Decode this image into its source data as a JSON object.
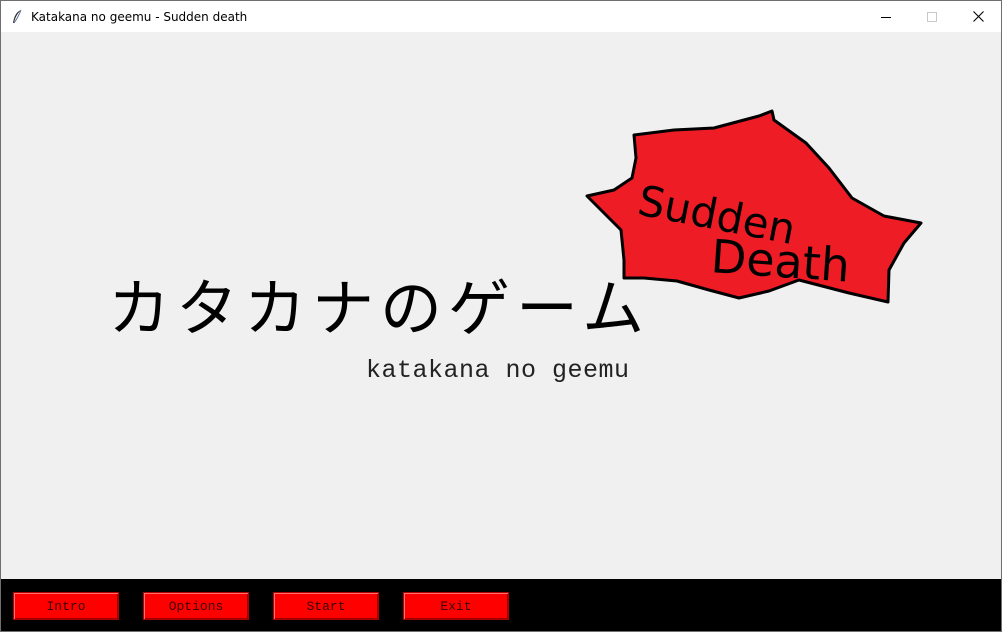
{
  "window": {
    "title": "Katakana no geemu - Sudden death",
    "icon": "feather-icon",
    "controls": [
      "minimize-icon",
      "maximize-icon",
      "close-icon"
    ]
  },
  "main": {
    "badge_text_line1": "Sudden",
    "badge_text_line2": "Death",
    "title_japanese": "カタカナのゲーム",
    "title_romaji": "katakana no geemu"
  },
  "menu": {
    "intro_label": "Intro",
    "options_label": "Options",
    "start_label": "Start",
    "exit_label": "Exit"
  },
  "colors": {
    "badge_red": "#ee1c25",
    "button_red": "#ff0000",
    "footer_bg": "#000000",
    "content_bg": "#f0f0f0"
  }
}
